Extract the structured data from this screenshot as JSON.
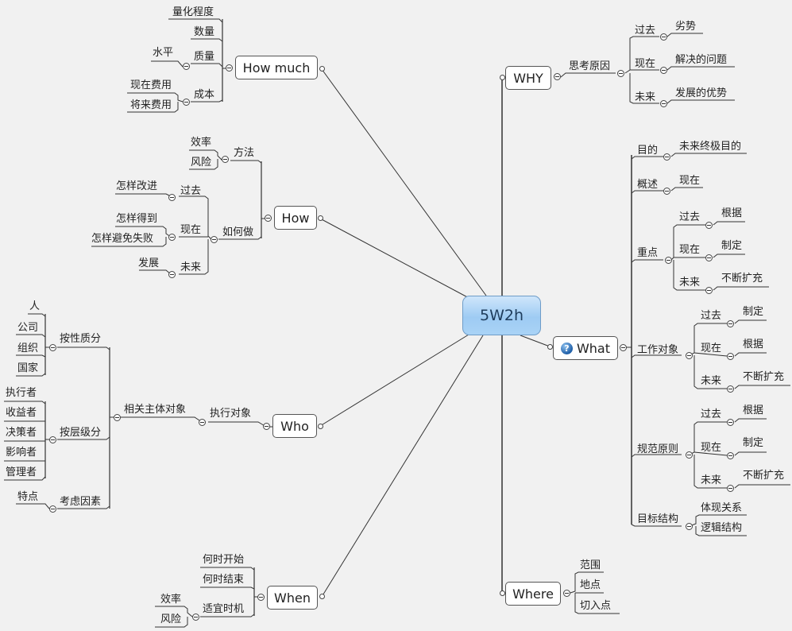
{
  "center": {
    "label": "5W2h"
  },
  "why": {
    "label": "WHY",
    "child": "思考原因",
    "items": [
      {
        "label": "过去",
        "child": "劣势"
      },
      {
        "label": "现在",
        "child": "解决的问题"
      },
      {
        "label": "未来",
        "child": "发展的优势"
      }
    ]
  },
  "what": {
    "label": "What",
    "icon": "question-icon",
    "items": {
      "goal": {
        "label": "目的",
        "child": "未来终极目的"
      },
      "overview": {
        "label": "概述",
        "child": "现在"
      },
      "focus": {
        "label": "重点",
        "items": [
          {
            "label": "过去",
            "child": "根据"
          },
          {
            "label": "现在",
            "child": "制定"
          },
          {
            "label": "未来",
            "child": "不断扩充"
          }
        ]
      },
      "work_object": {
        "label": "工作对象",
        "items": [
          {
            "label": "过去",
            "child": "制定"
          },
          {
            "label": "现在",
            "child": "根据"
          },
          {
            "label": "未来",
            "child": "不断扩充"
          }
        ]
      },
      "norms": {
        "label": "规范原则",
        "items": [
          {
            "label": "过去",
            "child": "根据"
          },
          {
            "label": "现在",
            "child": "制定"
          },
          {
            "label": "未来",
            "child": "不断扩充"
          }
        ]
      },
      "structure": {
        "label": "目标结构",
        "items": [
          "体现关系",
          "逻辑结构"
        ]
      }
    }
  },
  "where": {
    "label": "Where",
    "items": [
      "范围",
      "地点",
      "切入点"
    ]
  },
  "how_much": {
    "label": "How much",
    "items": {
      "degree": "量化程度",
      "quantity": "数量",
      "quality": {
        "label": "质量",
        "child": "水平"
      },
      "cost": {
        "label": "成本",
        "items": [
          "现在费用",
          "将来费用"
        ]
      }
    }
  },
  "how": {
    "label": "How",
    "method": {
      "label": "方法",
      "items": [
        "效率",
        "风险"
      ]
    },
    "howto": {
      "label": "如何做",
      "items": [
        {
          "label": "过去",
          "items": [
            "怎样改进"
          ]
        },
        {
          "label": "现在",
          "items": [
            "怎样得到",
            "怎样避免失败"
          ]
        },
        {
          "label": "未来",
          "items": [
            "发展"
          ]
        }
      ]
    }
  },
  "who": {
    "label": "Who",
    "child": "执行对象",
    "subject": {
      "label": "相关主体对象",
      "nature": {
        "label": "按性质分",
        "items": [
          "人",
          "公司",
          "组织",
          "国家"
        ]
      },
      "level": {
        "label": "按层级分",
        "items": [
          "执行者",
          "收益者",
          "决策者",
          "影响者",
          "管理者"
        ]
      },
      "factors": {
        "label": "考虑因素",
        "items": [
          "特点"
        ]
      }
    }
  },
  "when": {
    "label": "When",
    "items": {
      "start": "何时开始",
      "end": "何时结束",
      "timing": {
        "label": "适宜时机",
        "items": [
          "效率",
          "风险"
        ]
      }
    }
  }
}
